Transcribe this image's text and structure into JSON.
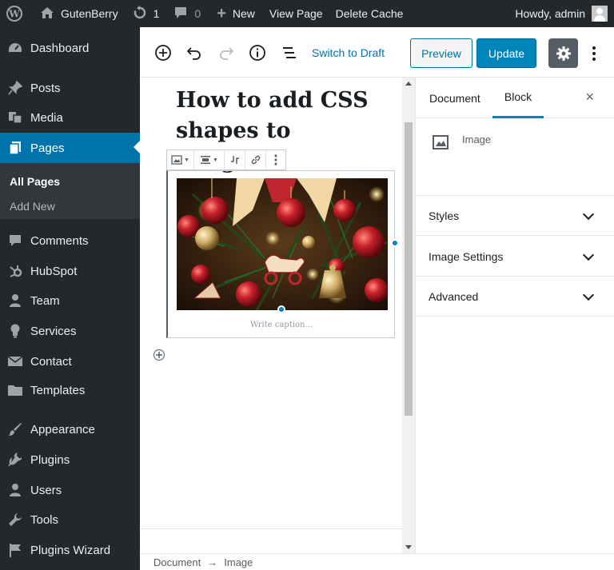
{
  "adminbar": {
    "site_name": "GutenBerry",
    "updates_count": "1",
    "comments_count": "0",
    "new_label": "New",
    "view_page": "View Page",
    "delete_cache": "Delete Cache",
    "howdy": "Howdy, admin"
  },
  "sidebar": {
    "items": [
      {
        "label": "Dashboard",
        "icon": "dashboard-icon"
      },
      {
        "label": "Posts",
        "icon": "pin-icon"
      },
      {
        "label": "Media",
        "icon": "media-icon"
      },
      {
        "label": "Pages",
        "icon": "pages-icon"
      },
      {
        "label": "Comments",
        "icon": "comment-icon"
      },
      {
        "label": "HubSpot",
        "icon": "hubspot-icon"
      },
      {
        "label": "Team",
        "icon": "person-icon"
      },
      {
        "label": "Services",
        "icon": "lightbulb-icon"
      },
      {
        "label": "Contact",
        "icon": "envelope-icon"
      },
      {
        "label": "Templates",
        "icon": "folder-icon"
      },
      {
        "label": "Appearance",
        "icon": "brush-icon"
      },
      {
        "label": "Plugins",
        "icon": "plug-icon"
      },
      {
        "label": "Users",
        "icon": "person-icon"
      },
      {
        "label": "Tools",
        "icon": "wrench-icon"
      },
      {
        "label": "Plugins Wizard",
        "icon": "flag-icon"
      }
    ],
    "submenu": [
      "All Pages",
      "Add New"
    ]
  },
  "toolbar": {
    "switch_draft": "Switch to Draft",
    "preview": "Preview",
    "update": "Update"
  },
  "editor": {
    "title": "How to add CSS shapes to images",
    "caption_placeholder": "Write caption..."
  },
  "settings": {
    "tab_document": "Document",
    "tab_block": "Block",
    "close": "×",
    "block_name": "Image",
    "panels": [
      "Styles",
      "Image Settings",
      "Advanced"
    ]
  },
  "footer": {
    "crumb_1": "Document",
    "arrow": "→",
    "crumb_2": "Image"
  },
  "colors": {
    "admin_dark": "#23282d",
    "accent": "#0073aa",
    "update_button": "#0085ba"
  }
}
